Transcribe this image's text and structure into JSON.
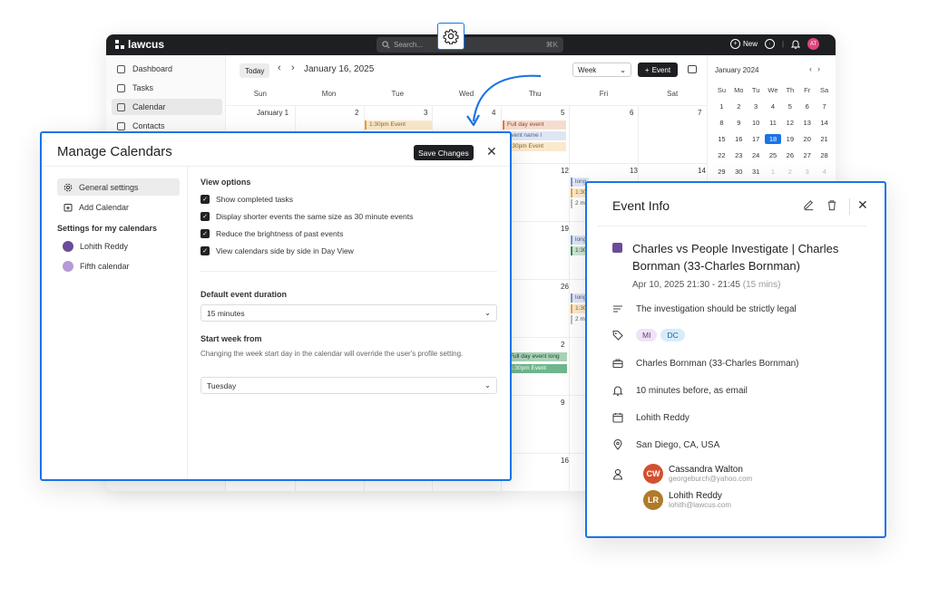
{
  "app": {
    "name": "lawcus"
  },
  "topbar": {
    "search_placeholder": "Search...",
    "search_shortcut": "⌘K",
    "new_label": "New",
    "avatar_initials": "AT"
  },
  "sidebar": {
    "items": [
      {
        "label": "Dashboard",
        "icon": "dashboard-icon"
      },
      {
        "label": "Tasks",
        "icon": "tasks-icon"
      },
      {
        "label": "Calendar",
        "icon": "calendar-icon",
        "active": true
      },
      {
        "label": "Contacts",
        "icon": "contacts-icon"
      }
    ]
  },
  "calendar": {
    "today_label": "Today",
    "current_date": "January 16, 2025",
    "view_select": "Week",
    "event_button": "Event",
    "weekdays": [
      "Sun",
      "Mon",
      "Tue",
      "Wed",
      "Thu",
      "Fri",
      "Sat"
    ],
    "first_row": [
      "January  1",
      "2",
      "3",
      "4",
      "5",
      "6",
      "7"
    ],
    "side_days": [
      "12",
      "13",
      "14",
      "19",
      "26",
      "2",
      "9",
      "16"
    ],
    "events": [
      "1:30pm Event",
      "Full day event",
      "Event name l",
      "1:30pm Event",
      "long",
      "1:30",
      "2 m",
      "long",
      "1:30",
      "long",
      "1:30",
      "2 m",
      "Full day event long",
      "1:30pm Event"
    ]
  },
  "minical": {
    "title": "January 2024",
    "headers": [
      "Su",
      "Mo",
      "Tu",
      "We",
      "Th",
      "Fr",
      "Sa"
    ],
    "weeks": [
      [
        "1",
        "2",
        "3",
        "4",
        "5",
        "6",
        "7"
      ],
      [
        "8",
        "9",
        "10",
        "11",
        "12",
        "13",
        "14"
      ],
      [
        "15",
        "16",
        "17",
        "18",
        "19",
        "20",
        "21"
      ],
      [
        "22",
        "23",
        "24",
        "25",
        "26",
        "27",
        "28"
      ],
      [
        "29",
        "30",
        "31",
        "1",
        "2",
        "3",
        "4"
      ]
    ],
    "selected": "18"
  },
  "manage": {
    "title": "Manage Calendars",
    "save_label": "Save Changes",
    "nav_general": "General settings",
    "nav_add": "Add Calendar",
    "my_calendars_heading": "Settings for my calendars",
    "calendars": [
      {
        "name": "Lohith Reddy",
        "color": "#6b4c9a"
      },
      {
        "name": "Fifth calendar",
        "color": "#b49ad6"
      }
    ],
    "view_options_heading": "View options",
    "view_options": [
      "Show completed tasks",
      "Display shorter events the same size as 30 minute events",
      "Reduce the brightness of past events",
      "View calendars side by side in Day View"
    ],
    "duration_heading": "Default event duration",
    "duration_value": "15 minutes",
    "week_start_heading": "Start week from",
    "week_start_help": "Changing the week start day in the calendar will override the user's profile setting.",
    "week_start_value": "Tuesday"
  },
  "event_info": {
    "title": "Event Info",
    "event_name": "Charles vs People Investigate | Charles Bornman (33-Charles Bornman)",
    "event_color": "#6b4c9a",
    "when": "Apr 10, 2025 21:30 - 21:45",
    "duration": "(15 mins)",
    "description": "The investigation should be strictly legal",
    "tags": [
      {
        "label": "MI",
        "bg": "#efe3f6",
        "fg": "#5a3d7a"
      },
      {
        "label": "DC",
        "bg": "#d6ecfb",
        "fg": "#1d5f8f"
      }
    ],
    "matter": "Charles Bornman (33-Charles Bornman)",
    "reminder": "10 minutes before, as email",
    "calendar": "Lohith Reddy",
    "location": "San Diego, CA, USA",
    "attendees": [
      {
        "initials": "CW",
        "name": "Cassandra Walton",
        "email": "georgeburch@yahoo.com",
        "color": "#d2502f"
      },
      {
        "initials": "LR",
        "name": "Lohith Reddy",
        "email": "lohith@lawcus.com",
        "color": "#b07a2a"
      }
    ]
  }
}
